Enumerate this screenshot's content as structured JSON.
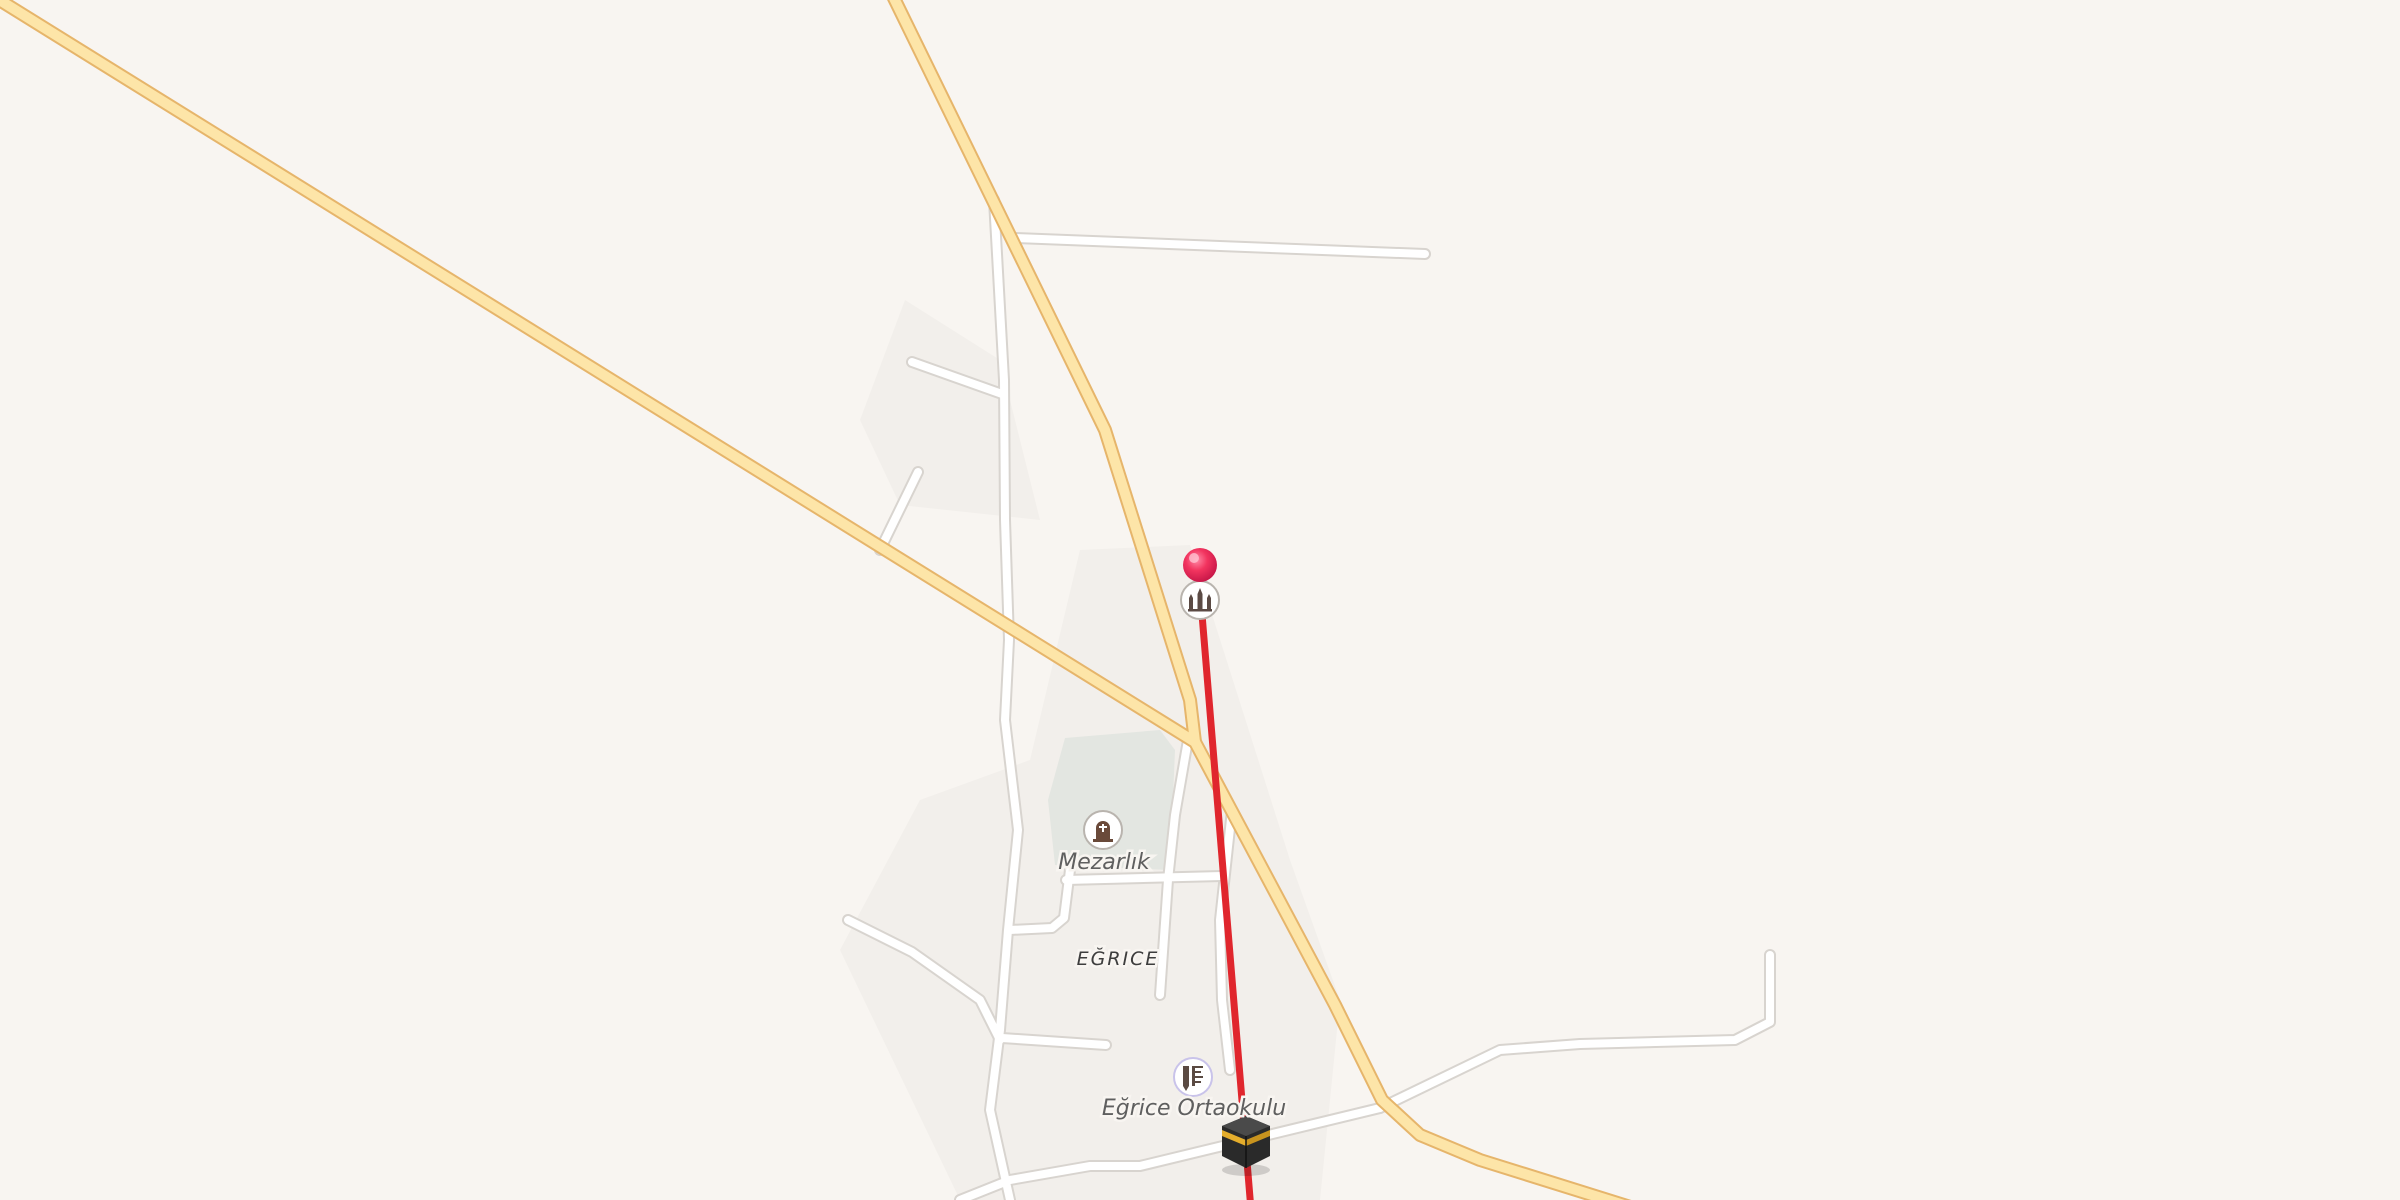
{
  "map": {
    "labels": {
      "cemetery": "Mezarlık",
      "village": "EĞRICE",
      "school": "Eğrice Ortaokulu"
    },
    "icons": {
      "mosque": "mosque-icon",
      "cemetery": "cemetery-icon",
      "school": "school-icon",
      "kaaba": "kaaba-icon",
      "location_pin": "location-pin-icon"
    },
    "colors": {
      "background": "#f8f5f1",
      "primary_road": "#fde5a8",
      "primary_road_casing": "#e7b56a",
      "minor_road": "#ffffff",
      "minor_road_casing": "#d9d5d0",
      "settlement_area": "#f1eeea",
      "cemetery_area": "#e1e4df",
      "qibla_line": "#e0262d",
      "location_pin": "#f2345f"
    }
  }
}
